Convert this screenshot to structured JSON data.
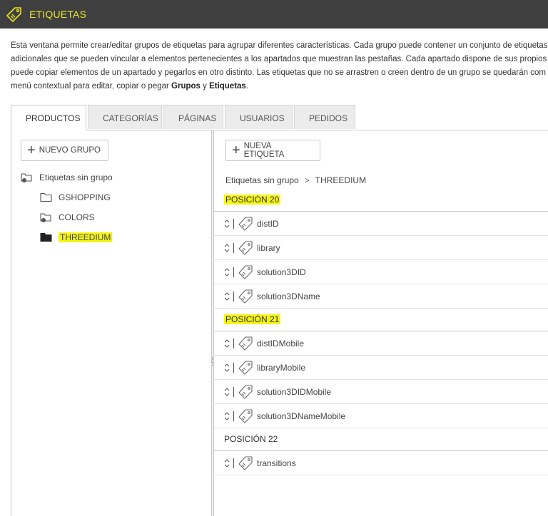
{
  "header": {
    "title": "ETIQUETAS",
    "icon": "tag-icon",
    "accent": "#e8e42a",
    "bg": "#3f3f3f"
  },
  "description": {
    "line1": "Esta ventana permite crear/editar grupos de etiquetas para agrupar diferentes características. Cada grupo puede contener un conjunto de etiquetas",
    "line2": "adicionales que se pueden vincular a elementos pertenecientes a los apartados que muestran las pestañas. Cada apartado dispone de sus propios g",
    "line3": "puede copiar elementos de un apartado y pegarlos en otro distinto. Las etiquetas que no se arrastren o creen dentro de un grupo se quedarán com",
    "line4_pre": "menú contextual para editar, copiar o pegar ",
    "line4_b1": "Grupos",
    "line4_mid": " y ",
    "line4_b2": "Etiquetas",
    "line4_end": "."
  },
  "tabs": [
    "PRODUCTOS",
    "CATEGORÍAS",
    "PÁGINAS",
    "USUARIOS",
    "PEDIDOS"
  ],
  "left": {
    "new_group_label": "NUEVO GRUPO",
    "tree": {
      "root": "Etiquetas sin grupo",
      "children": [
        "GSHOPPING",
        "COLORS",
        "THREEDIUM"
      ]
    }
  },
  "right": {
    "new_tag_label": "NUEVA ETIQUETA",
    "breadcrumb": {
      "root": "Etiquetas sin grupo",
      "sep": ">",
      "current": "THREEDIUM"
    },
    "sections": [
      {
        "label": "POSICIÓN 20",
        "items": [
          "distID",
          "library",
          "solution3DID",
          "solution3DName"
        ]
      },
      {
        "label": "POSICIÓN 21",
        "items": [
          "distIDMobile",
          "libraryMobile",
          "solution3DIDMobile",
          "solution3DNameMobile"
        ]
      },
      {
        "label": "POSICIÓN 22",
        "items": [
          "transitions"
        ]
      }
    ]
  },
  "highlight_color": "#f4f417"
}
